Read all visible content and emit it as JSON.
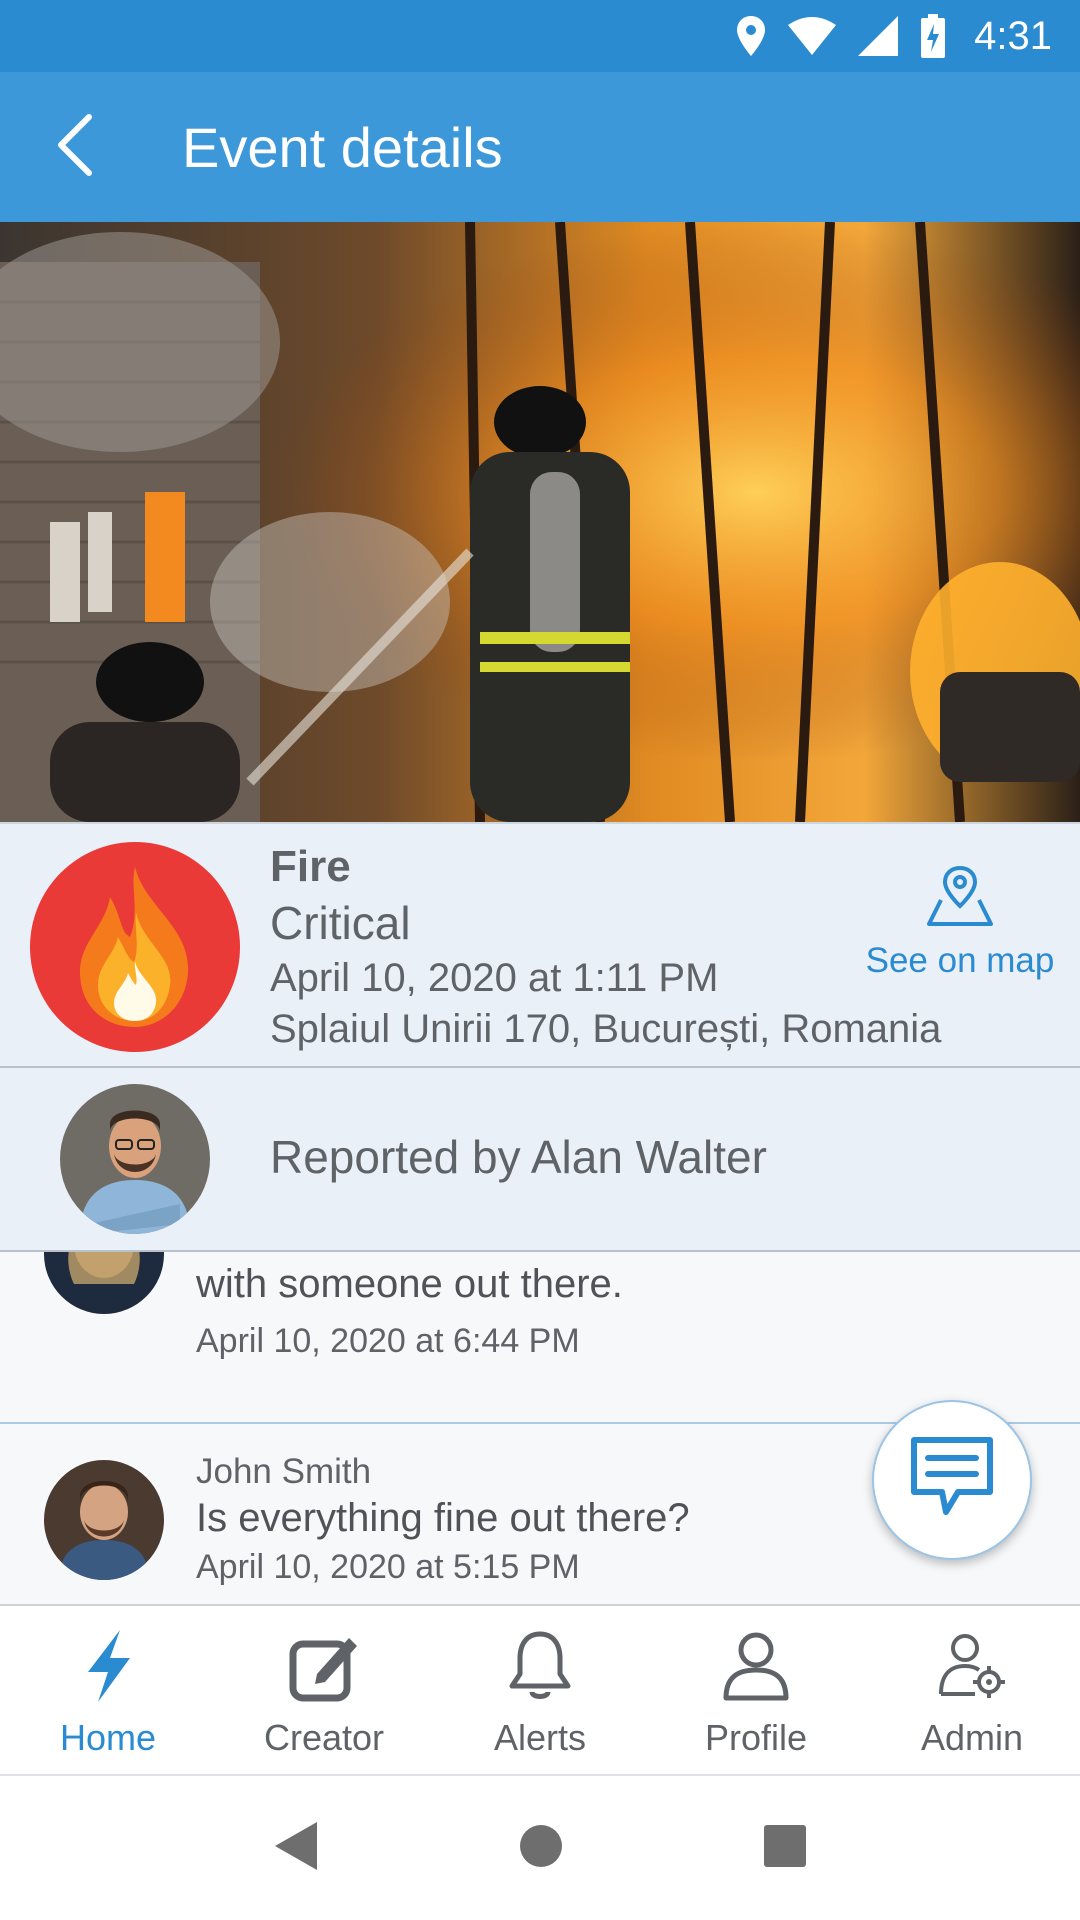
{
  "status_bar": {
    "time": "4:31"
  },
  "app_bar": {
    "title": "Event details"
  },
  "event": {
    "type": "Fire",
    "severity": "Critical",
    "date": "April 10, 2020 at 1:11 PM",
    "address": "Splaiul Unirii 170, București, Romania",
    "see_on_map_label": "See on map",
    "icon": "fire-icon",
    "icon_color": "#ea3a37"
  },
  "reporter": {
    "text": "Reported by Alan Walter"
  },
  "comments": [
    {
      "author": "",
      "body": "with someone out there.",
      "time": "April 10, 2020 at 6:44 PM"
    },
    {
      "author": "John Smith",
      "body": "Is everything fine out there?",
      "time": "April 10, 2020 at 5:15 PM"
    }
  ],
  "bottom_nav": {
    "items": [
      {
        "label": "Home",
        "icon": "bolt-icon",
        "active": true
      },
      {
        "label": "Creator",
        "icon": "edit-icon",
        "active": false
      },
      {
        "label": "Alerts",
        "icon": "bell-icon",
        "active": false
      },
      {
        "label": "Profile",
        "icon": "person-icon",
        "active": false
      },
      {
        "label": "Admin",
        "icon": "admin-icon",
        "active": false
      }
    ]
  },
  "colors": {
    "primary": "#3d98da",
    "status_bar": "#2a8bd0",
    "accent": "#2a8bd0",
    "card_bg": "#eaf0f7"
  }
}
